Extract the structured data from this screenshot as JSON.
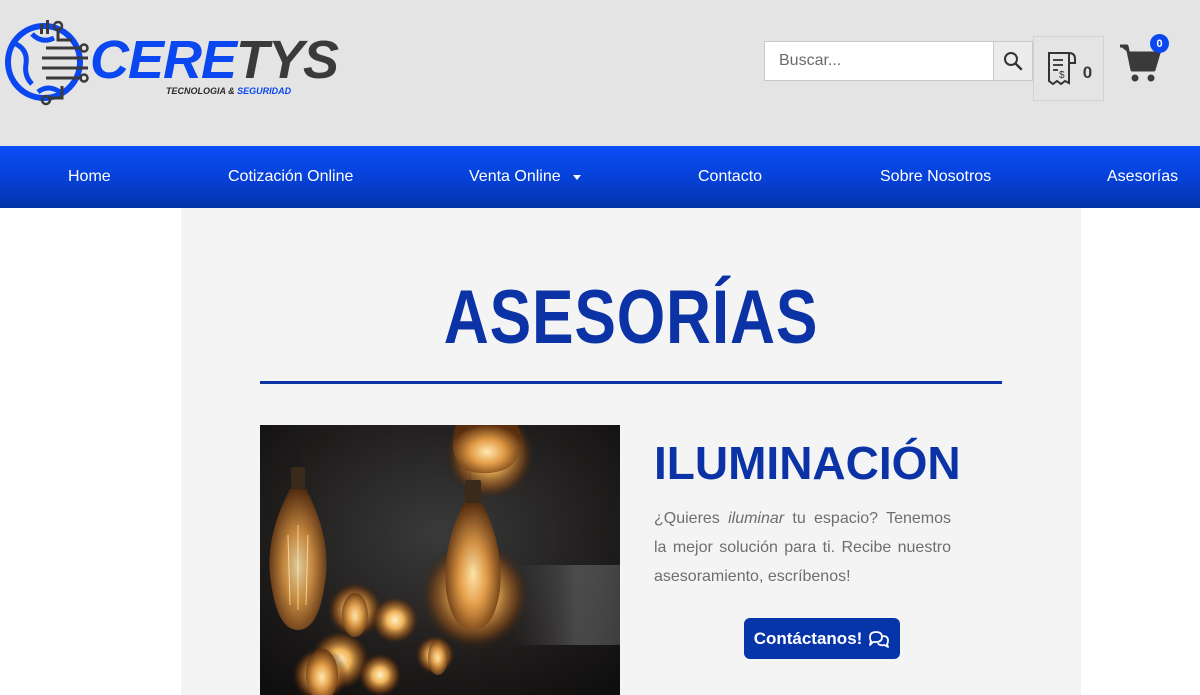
{
  "brand": {
    "name_part1": "CERE",
    "name_part2": "TYS",
    "tagline_part1": "TECNOLOGIA & ",
    "tagline_part2": "SEGURIDAD"
  },
  "header": {
    "search_placeholder": "Buscar...",
    "quote_count": "0",
    "cart_count": "0"
  },
  "nav": {
    "items": [
      {
        "label": "Home"
      },
      {
        "label": "Cotización Online"
      },
      {
        "label": "Venta Online"
      },
      {
        "label": "Contacto"
      },
      {
        "label": "Sobre Nosotros"
      },
      {
        "label": "Asesorías"
      }
    ]
  },
  "main": {
    "title": "ASESORÍAS",
    "section": {
      "title": "ILUMINACIÓN",
      "text_before": "¿Quieres ",
      "text_em": "iluminar",
      "text_after": " tu espacio? Tenemos la mejor solución para ti. Recibe nuestro asesoramiento, escríbenos!",
      "cta_label": "Contáctanos!"
    }
  },
  "icons": {
    "search": "search-icon",
    "quote": "receipt-icon",
    "cart": "cart-icon",
    "chat": "chat-icon",
    "dropdown": "caret-down-icon"
  },
  "colors": {
    "brand_blue": "#0a47f0",
    "title_blue": "#0b33a6",
    "header_bg": "#e4e4e4",
    "panel_bg": "#f4f4f5"
  }
}
